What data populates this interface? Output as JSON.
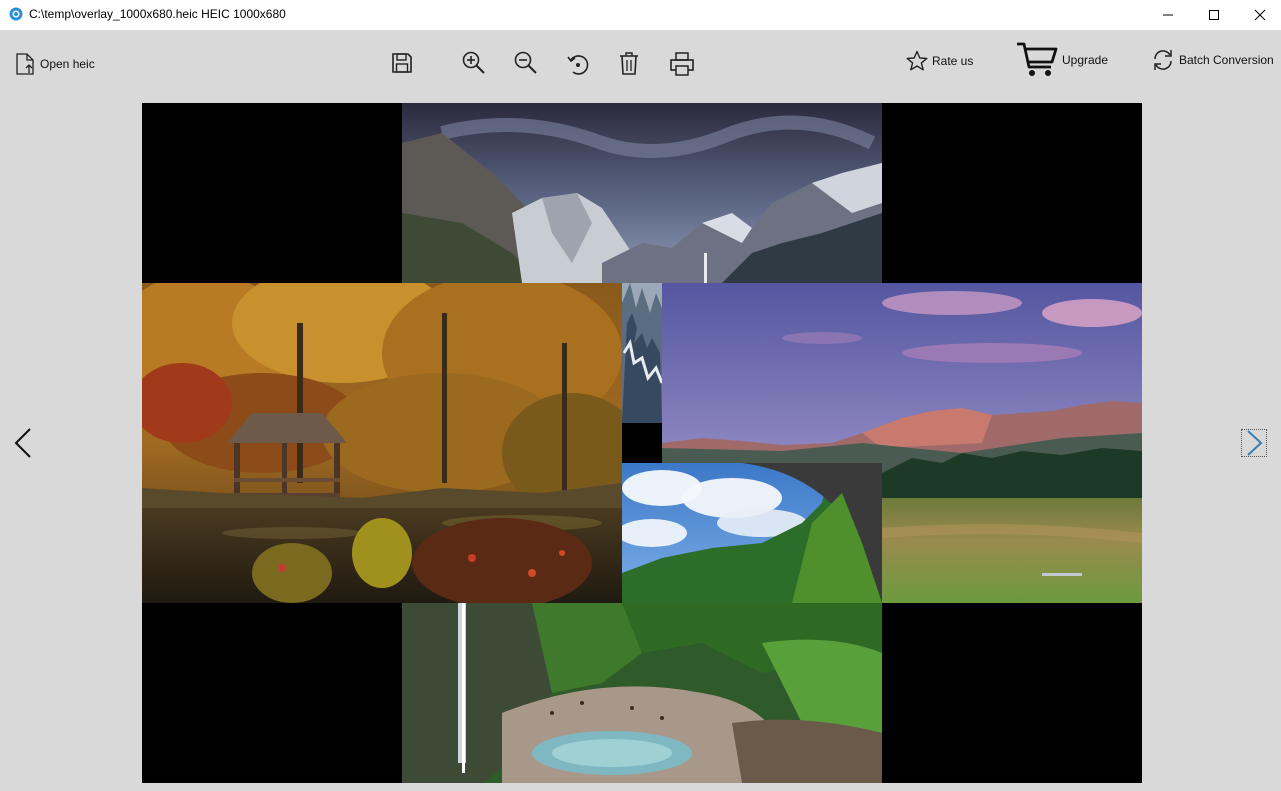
{
  "window": {
    "title": "C:\\temp\\overlay_1000x680.heic HEIC 1000x680",
    "minimize_icon": "minimize-icon",
    "maximize_icon": "maximize-icon",
    "close_icon": "close-icon"
  },
  "toolbar": {
    "open_label": "Open heic",
    "open_icon": "file-upload-icon",
    "save_icon": "floppy-disk-icon",
    "zoom_in_icon": "zoom-in-icon",
    "zoom_out_icon": "zoom-out-icon",
    "rotate_icon": "rotate-icon",
    "delete_icon": "trash-icon",
    "print_icon": "printer-icon",
    "rate_label": "Rate us",
    "rate_icon": "star-icon",
    "upgrade_label": "Upgrade",
    "upgrade_icon": "cart-icon",
    "batch_label": "Batch Conversion",
    "batch_icon": "refresh-icon"
  },
  "viewer": {
    "background": "#000000",
    "tiles": [
      "mountain-snow-tile",
      "snowy-forest-strip",
      "autumn-pavilion-tile",
      "meadow-mountains-tile",
      "waterfall-canyon-tile",
      "green-valley-sky-tile"
    ]
  },
  "navigation": {
    "prev_icon": "chevron-left-icon",
    "next_icon": "chevron-right-icon",
    "next_color": "#3a7fb0"
  },
  "colors": {
    "toolbar_bg": "#d9d9d9",
    "titlebar_bg": "#ffffff"
  }
}
